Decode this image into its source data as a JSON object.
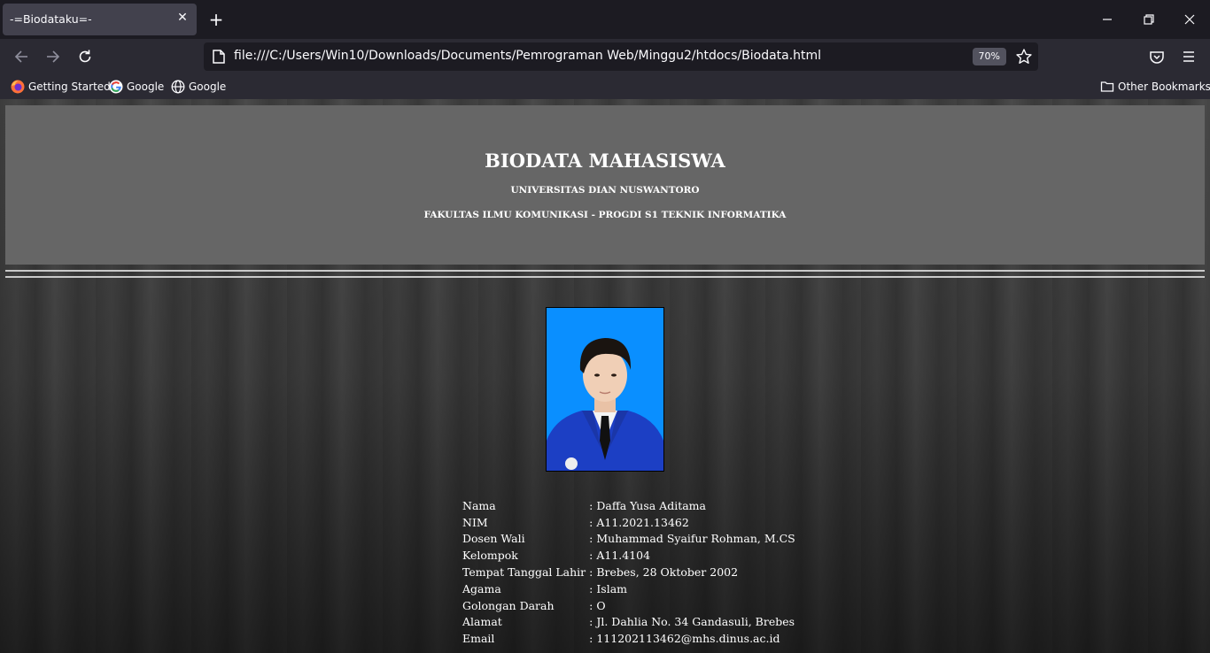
{
  "browser": {
    "tab_title": "-=Biodataku=-",
    "url": "file:///C:/Users/Win10/Downloads/Documents/Pemrograman Web/Minggu2/htdocs/Biodata.html",
    "zoom": "70%",
    "bookmarks": [
      {
        "label": "Getting Started",
        "icon": "firefox-icon"
      },
      {
        "label": "Google",
        "icon": "google-icon"
      },
      {
        "label": "Google",
        "icon": "globe-icon"
      }
    ],
    "other_bookmarks": "Other Bookmarks"
  },
  "header": {
    "title": "BIODATA MAHASISWA",
    "university": "UNIVERSITAS DIAN NUSWANTORO",
    "faculty": "FAKULTAS ILMU KOMUNIKASI - PROGDI S1 TEKNIK INFORMATIKA",
    "background_color": "#666666"
  },
  "profile": {
    "rows": [
      {
        "key": "Nama",
        "value": ": Daffa Yusa Aditama"
      },
      {
        "key": "NIM",
        "value": ": A11.2021.13462"
      },
      {
        "key": "Dosen Wali",
        "value": ": Muhammad Syaifur Rohman, M.CS"
      },
      {
        "key": "Kelompok",
        "value": ": A11.4104"
      },
      {
        "key": "Tempat Tanggal Lahir",
        "value": ": Brebes, 28 Oktober 2002"
      },
      {
        "key": "Agama",
        "value": ": Islam"
      },
      {
        "key": "Golongan Darah",
        "value": ": O"
      },
      {
        "key": "Alamat",
        "value": ": Jl. Dahlia No. 34 Gandasuli, Brebes"
      },
      {
        "key": "Email",
        "value": ": 111202113462@mhs.dinus.ac.id"
      }
    ]
  }
}
